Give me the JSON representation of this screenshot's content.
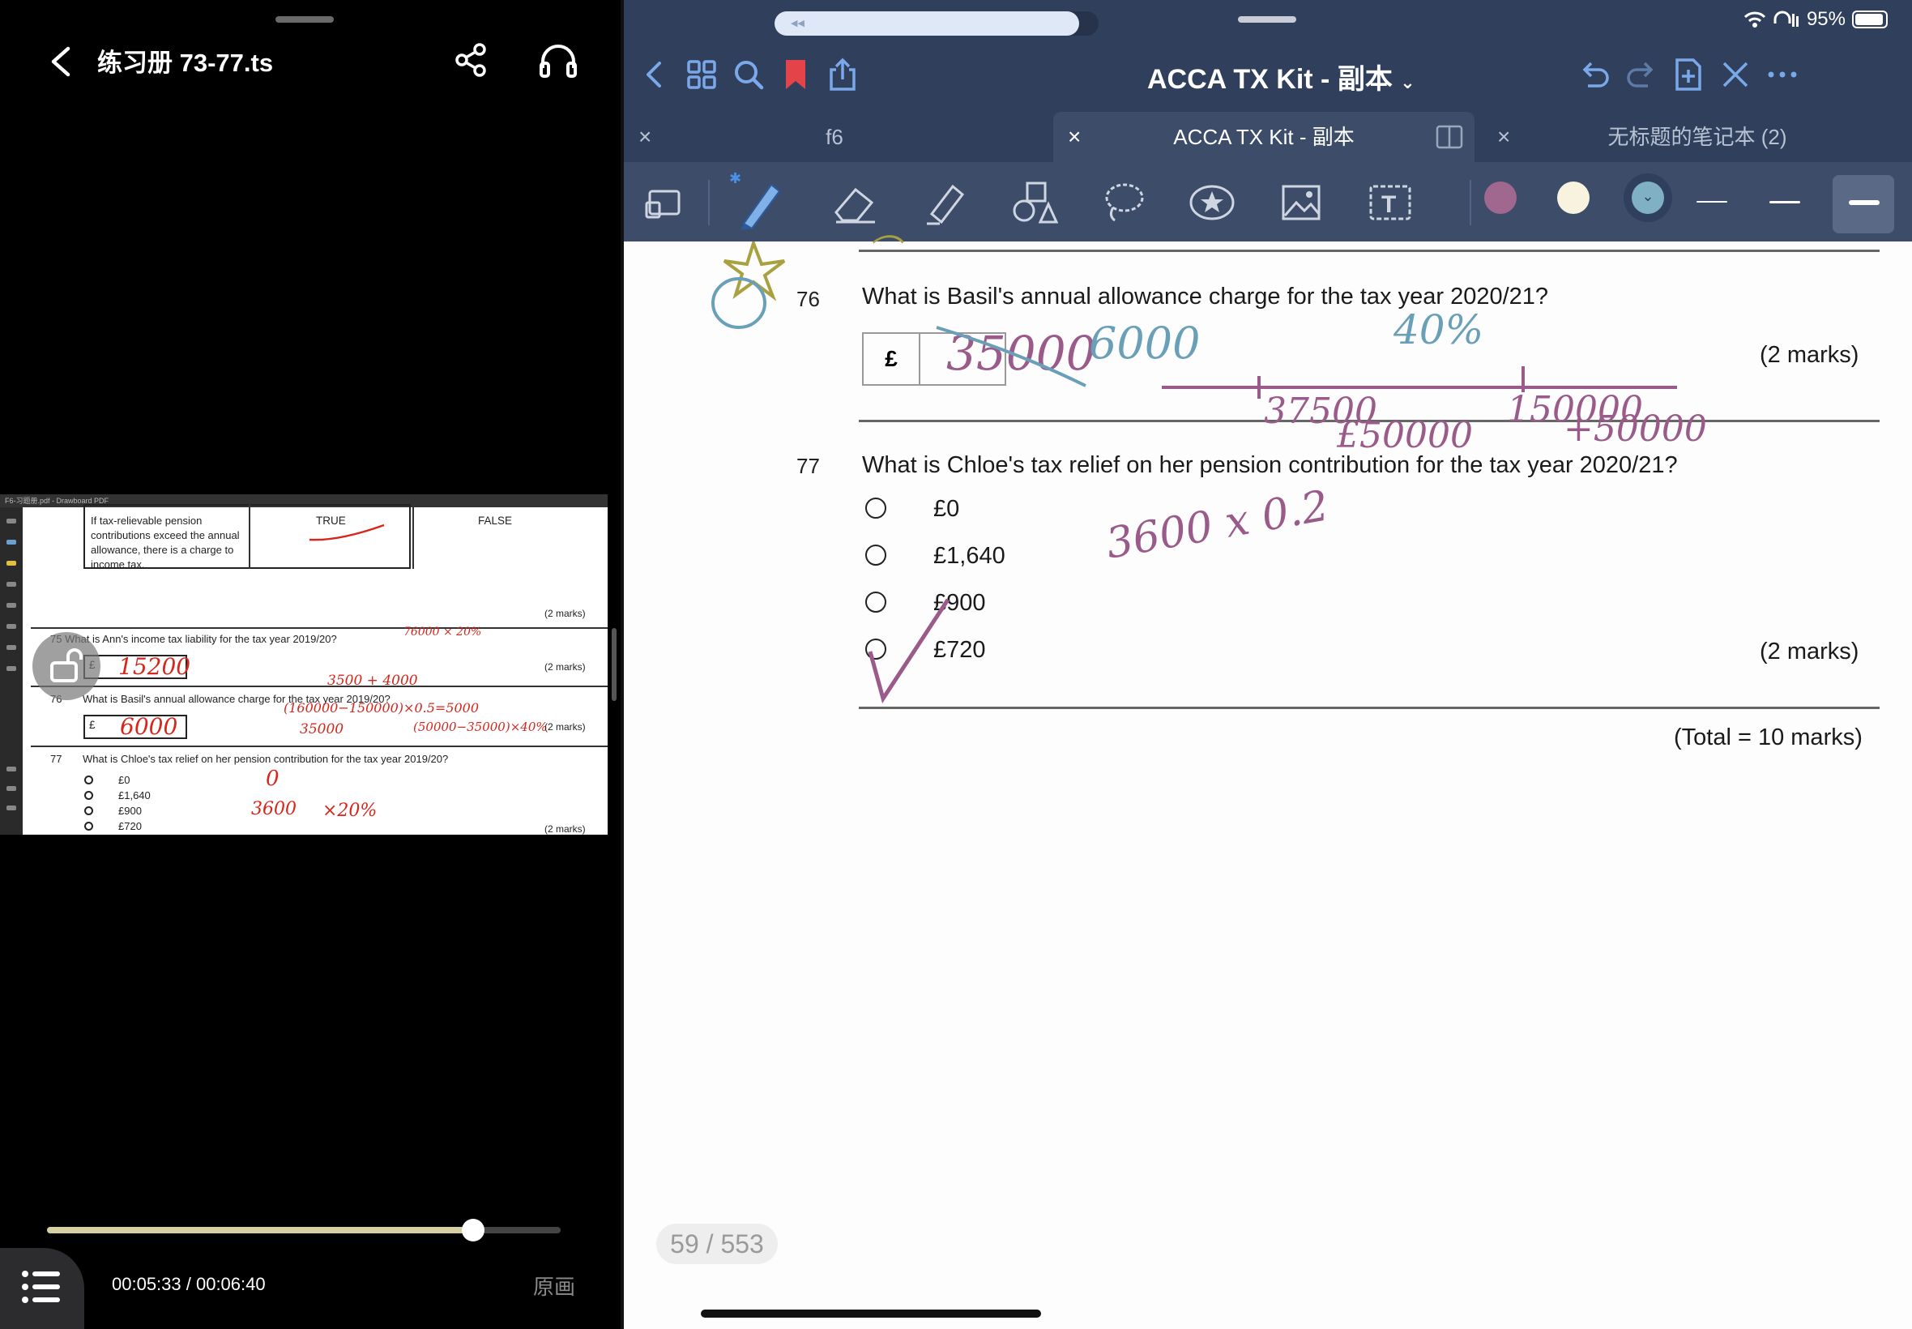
{
  "player": {
    "title": "练习册 73-77.ts",
    "timecode": "00:05:33 / 00:06:40",
    "progress": 0.83,
    "original_label": "原画",
    "icons": [
      "back-icon",
      "share-icon",
      "headphones-icon",
      "list-icon",
      "lock-icon"
    ]
  },
  "video_frame": {
    "window_title": "F6-习题册.pdf - Drawboard PDF",
    "statement": "If tax-relievable pension contributions exceed the annual allowance, there is a charge to income tax.",
    "true_label": "TRUE",
    "false_label": "FALSE",
    "marks": "(2 marks)",
    "q75": "75 What is Ann's income tax liability for the tax year 2019/20?",
    "q75_answer": "15200",
    "q75_note_a": "76000 × 20%",
    "q75_note_b": "3500 + 4000",
    "q76_num": "76",
    "q76": "What is Basil's annual allowance charge for the tax year 2019/20?",
    "q76_answer": "6000",
    "q76_note_a": "(160000−150000)×0.5=5000",
    "q76_note_b": "35000",
    "q76_note_c": "(50000−35000)×40%",
    "q77_num": "77",
    "q77": "What is Chloe's tax relief on her pension contribution for the tax year 2019/20?",
    "q77_options": [
      "£0",
      "£1,640",
      "£900",
      "£720"
    ],
    "q77_note_a": "0",
    "q77_note_b": "3600",
    "q77_note_c": "×20%",
    "pound": "£"
  },
  "status": {
    "battery": "95%",
    "battery_level": 0.95
  },
  "notes_app": {
    "document_title": "ACCA TX Kit - 副本",
    "tabs": [
      {
        "label": "f6",
        "active": false
      },
      {
        "label": "ACCA TX Kit - 副本",
        "active": true
      },
      {
        "label": "无标题的笔记本 (2)",
        "active": false
      }
    ],
    "colors": {
      "purple": "#a0678f",
      "cream": "#f7f3df",
      "blue": "#7fb0c4",
      "topbar": "#2f3f5c"
    }
  },
  "page": {
    "q76_num": "76",
    "q76_text": "What is Basil's annual allowance charge for the tax year 2020/21?",
    "pound": "£",
    "q76_marks": "(2 marks)",
    "q77_num": "77",
    "q77_text": "What is Chloe's tax relief on her pension contribution for the tax year 2020/21?",
    "q77_options": [
      "£0",
      "£1,640",
      "£900",
      "£720"
    ],
    "q77_marks": "(2 marks)",
    "total": "(Total = 10 marks)",
    "page_indicator": "59 / 553",
    "ink": {
      "crossed": "35000",
      "answer": "6000",
      "percent": "40%",
      "n1": "37500",
      "n2": "£50000",
      "n3": "150000",
      "n4": "+50000",
      "calc": "3600 x 0.2"
    }
  }
}
